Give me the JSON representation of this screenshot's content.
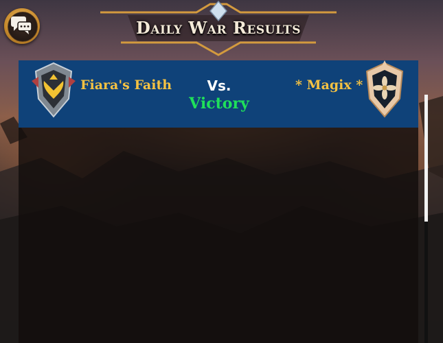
{
  "header": {
    "title": "Daily War Results",
    "chat_icon": "chat-bubbles-icon"
  },
  "matchup": {
    "left_guild": "Fiara's Faith",
    "left_crest": "winged-shield-crest-icon",
    "vs_label": "Vs.",
    "outcome": "Victory",
    "right_guild": "* Magix *",
    "right_crest": "flower-shield-crest-icon"
  },
  "colors": {
    "bar": "#0f4279",
    "guild_text": "#f5c242",
    "outcome_text": "#1fe05a",
    "title_text": "#f4ead8"
  },
  "scroll": {
    "visible_fraction": 0.51
  }
}
